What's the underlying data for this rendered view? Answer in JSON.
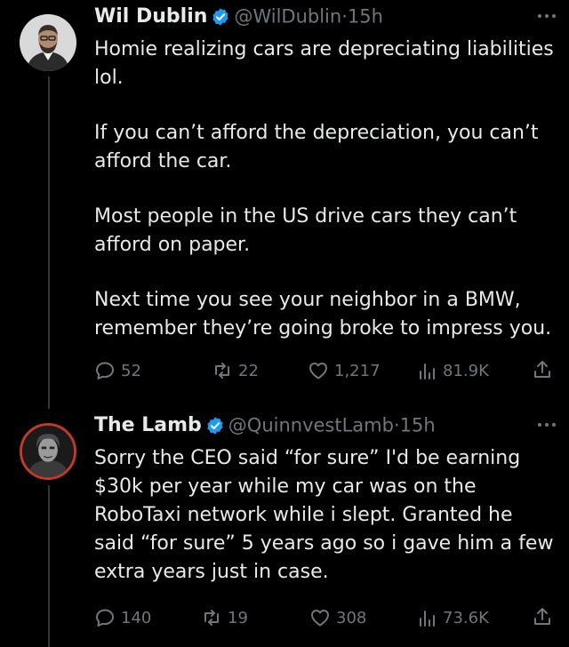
{
  "tweets": [
    {
      "name": "Wil Dublin",
      "handle": "@WilDublin",
      "separator": "·",
      "time": "15h",
      "paragraphs": [
        "Homie realizing cars are depreciating liabilities\nlol.",
        "If you can’t afford the depreciation, you can’t\nafford the car.",
        "Most people in the US drive cars they can’t\nafford on paper.",
        "Next time you see your neighbor in a BMW,\nremember they’re going broke to impress you."
      ],
      "replies": "52",
      "reposts": "22",
      "likes": "1,217",
      "views": "81.9K"
    },
    {
      "name": "The Lamb",
      "handle": "@QuinnvestLamb",
      "separator": "·",
      "time": "15h",
      "paragraphs": [
        "Sorry the CEO said “for sure” I'd be earning\n$30k per year while my car was on the\nRoboTaxi network while i slept. Granted he\nsaid “for sure” 5 years ago so i gave him a few\nextra years just in case."
      ],
      "replies": "140",
      "reposts": "19",
      "likes": "308",
      "views": "73.6K"
    }
  ],
  "colors": {
    "background": "#000000",
    "text": "#e7e9ea",
    "muted": "#71767b",
    "verified": "#1d9bf0",
    "thread_line": "#333639"
  },
  "icons": {
    "verified": "verified-badge-icon",
    "more": "more-options-icon",
    "reply": "reply-icon",
    "repost": "repost-icon",
    "like": "like-icon",
    "views": "views-icon",
    "share": "share-icon"
  }
}
